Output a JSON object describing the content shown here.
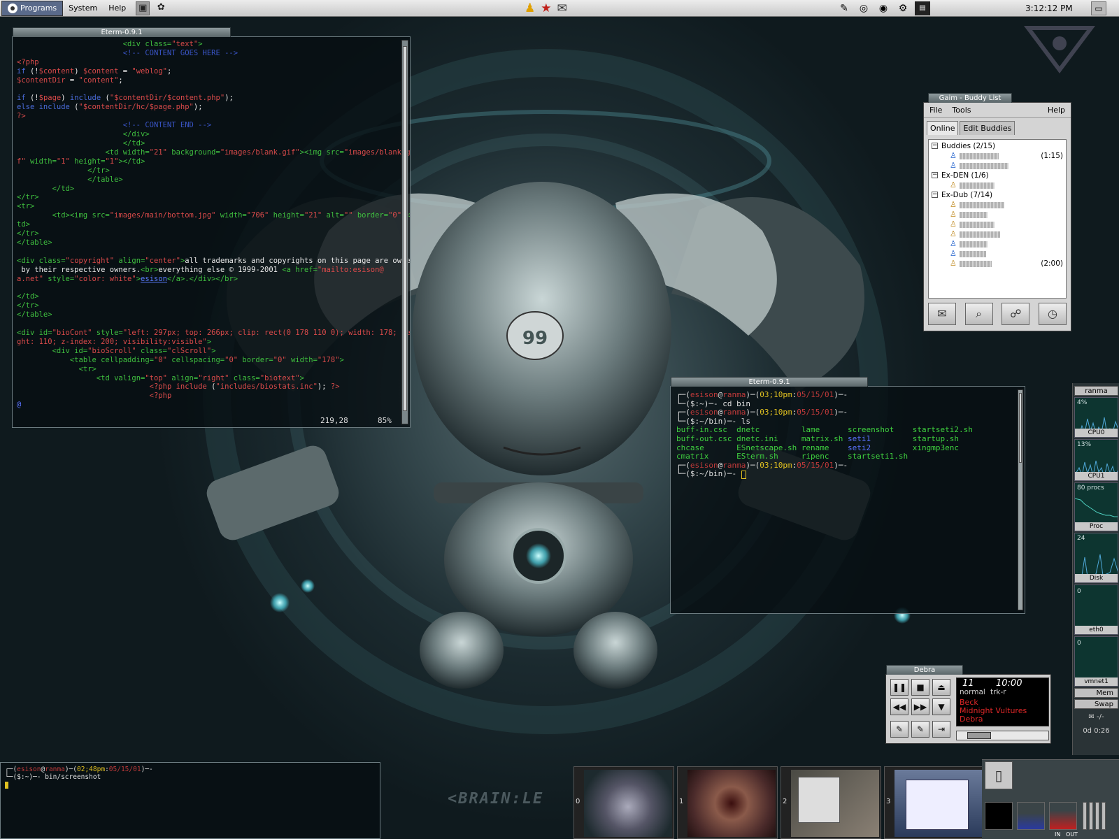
{
  "panel": {
    "menus": [
      "Programs",
      "System",
      "Help"
    ],
    "clock": "3:12:12 PM",
    "launchers": [
      "terminal-launcher",
      "gimp-launcher"
    ],
    "center_icons": [
      "person-icon",
      "star-icon",
      "mail-icon"
    ],
    "tray_icons": [
      "pencil-icon",
      "cd-icon",
      "disc-icon",
      "network-icon",
      "monitor-icon"
    ]
  },
  "editor": {
    "title": "Eterm-0.9.1",
    "cursor_pos": "219,28",
    "percent": "85%"
  },
  "terminal": {
    "title": "Eterm-0.9.1",
    "prompt_user": "esison",
    "prompt_host": "ranma",
    "time": "03;10pm",
    "date": "05/15/01",
    "cmd1": "cd bin",
    "cmd2": "ls",
    "files": [
      [
        "buff-in.csc",
        "dnetc",
        "lame",
        "screenshot",
        "startseti2.sh"
      ],
      [
        "buff-out.csc",
        "dnetc.ini",
        "matrix.sh",
        "seti1",
        "startup.sh"
      ],
      [
        "chcase",
        "ESnetscape.sh",
        "rename",
        "seti2",
        "xingmp3enc"
      ],
      [
        "cmatrix",
        "ESterm.sh",
        "ripenc",
        "startseti1.sh",
        ""
      ]
    ]
  },
  "gaim": {
    "title": "Gaim - Buddy List",
    "menu": {
      "file": "File",
      "tools": "Tools",
      "help": "Help"
    },
    "tabs": {
      "online": "Online",
      "edit": "Edit Buddies"
    },
    "groups": [
      {
        "name": "Buddies (2/15)",
        "buddies": [
          {
            "idle": "(1:15)",
            "away": false
          },
          {
            "idle": "",
            "away": false
          }
        ]
      },
      {
        "name": "Ex-DEN (1/6)",
        "buddies": [
          {
            "idle": "",
            "away": true
          }
        ]
      },
      {
        "name": "Ex-Dub (7/14)",
        "buddies": [
          {
            "idle": "",
            "away": true
          },
          {
            "idle": "",
            "away": true
          },
          {
            "idle": "",
            "away": true
          },
          {
            "idle": "",
            "away": true
          },
          {
            "idle": "",
            "away": false
          },
          {
            "idle": "",
            "away": false
          },
          {
            "idle": "(2:00)",
            "away": true
          }
        ]
      }
    ],
    "buttons": [
      "send-message-icon",
      "get-info-icon",
      "chat-icon",
      "away-icon"
    ]
  },
  "dock": {
    "host": "ranma",
    "cpu0_pct": "4%",
    "cpu0_label": "CPU0",
    "cpu1_pct": "13%",
    "cpu1_label": "CPU1",
    "procs_value": "80 procs",
    "proc_label": "Proc",
    "proc_num": "24",
    "disk_label": "Disk",
    "disk_value": "0",
    "eth_label": "eth0",
    "eth_value": "0",
    "vmnet_label": "vmnet1",
    "mem_label": "Mem",
    "swap_label": "Swap",
    "net_symbol": "-/-",
    "uptime": "0d 0:26"
  },
  "player": {
    "title": "Debra",
    "time_left": "11",
    "time_right": "10:00",
    "mode_left": "normal",
    "mode_right": "trk-r",
    "artist": "Beck",
    "album": "Midnight Vultures",
    "track": "Debra",
    "position": 0.15
  },
  "small_term": {
    "user": "esison",
    "host": "ranma",
    "time": "02;48pm",
    "date": "05/15/01",
    "cmd": "bin/screenshot"
  },
  "pager": {
    "workspaces": [
      "0",
      "1",
      "2",
      "3"
    ],
    "meter_labels": {
      "in": "IN",
      "out": "OUT"
    }
  },
  "wallpaper": {
    "text": "<BRAIN:LE"
  }
}
